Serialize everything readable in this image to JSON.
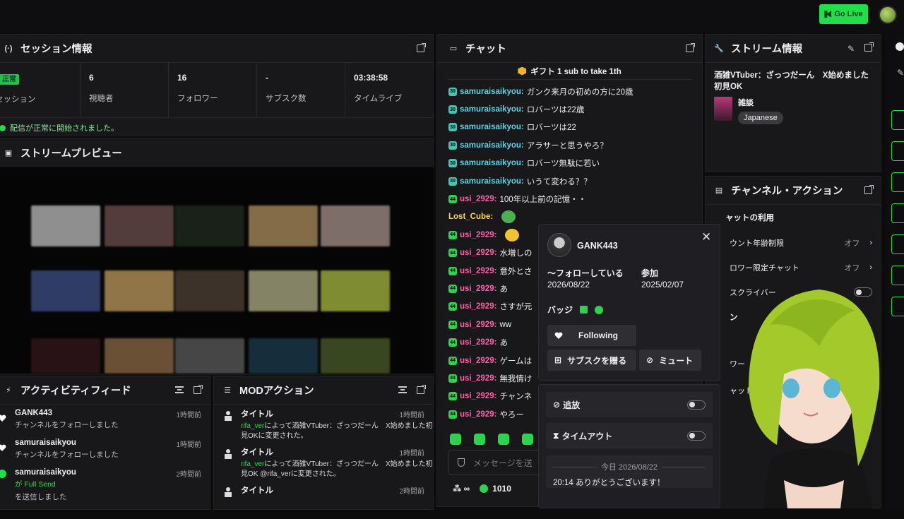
{
  "topbar": {
    "go_live": "Go Live"
  },
  "session": {
    "title": "セッション情報",
    "stats": [
      {
        "value": "正常",
        "label": "セッション",
        "badge": true
      },
      {
        "value": "6",
        "label": "視聴者"
      },
      {
        "value": "16",
        "label": "フォロワー"
      },
      {
        "value": "-",
        "label": "サブスク数"
      },
      {
        "value": "03:38:58",
        "label": "タイムライブ"
      }
    ],
    "status": "配信が正常に開始されました。"
  },
  "preview": {
    "title": "ストリームプレビュー"
  },
  "chat": {
    "title": "チャット",
    "gift": "ギフト 1 sub to take 1th",
    "messages": [
      {
        "user": "samuraisaikyou:",
        "text": "ガンク来月の初めの方に20歳",
        "color": "cyan",
        "badge": "30"
      },
      {
        "user": "samuraisaikyou:",
        "text": "ロバーツは22歳",
        "color": "cyan",
        "badge": "30"
      },
      {
        "user": "samuraisaikyou:",
        "text": "ロバーツは22",
        "color": "cyan",
        "badge": "30"
      },
      {
        "user": "samuraisaikyou:",
        "text": "アラサーと思うやろ？",
        "color": "cyan",
        "badge": "30"
      },
      {
        "user": "samuraisaikyou:",
        "text": "ロバーツ無駄に若い",
        "color": "cyan",
        "badge": "30"
      },
      {
        "user": "samuraisaikyou:",
        "text": "いうて変わる？？",
        "color": "cyan",
        "badge": "30"
      },
      {
        "user": "usi_2929:",
        "text": "100年以上前の記憶・・",
        "color": "pink",
        "badge": "44"
      },
      {
        "user": "Lost_Cube:",
        "text": "",
        "color": "yel",
        "badge": ""
      },
      {
        "user": "usi_2929:",
        "text": "",
        "color": "pink",
        "badge": "44"
      },
      {
        "user": "usi_2929:",
        "text": "水増しの",
        "color": "pink",
        "badge": "44"
      },
      {
        "user": "usi_2929:",
        "text": "意外とさ",
        "color": "pink",
        "badge": "44"
      },
      {
        "user": "usi_2929:",
        "text": "あ",
        "color": "pink",
        "badge": "44"
      },
      {
        "user": "usi_2929:",
        "text": "さすが元",
        "color": "pink",
        "badge": "44"
      },
      {
        "user": "usi_2929:",
        "text": "ww",
        "color": "pink",
        "badge": "44"
      },
      {
        "user": "usi_2929:",
        "text": "あ",
        "color": "pink",
        "badge": "44"
      },
      {
        "user": "usi_2929:",
        "text": "ゲームは",
        "color": "pink",
        "badge": "44"
      },
      {
        "user": "usi_2929:",
        "text": "無我情け",
        "color": "pink",
        "badge": "44"
      },
      {
        "user": "usi_2929:",
        "text": "チャンネ",
        "color": "pink",
        "badge": "44"
      },
      {
        "user": "usi_2929:",
        "text": "やろー",
        "color": "pink",
        "badge": "44"
      }
    ],
    "input_placeholder": "メッセージを送",
    "points": "1010"
  },
  "stream_info": {
    "title": "ストリーム情報",
    "stream_title": "酒雑VTuber：ざっつだーん　X始めました初見OK",
    "category": "雑談",
    "tag": "Japanese"
  },
  "channel_actions": {
    "title": "チャンネル・アクション",
    "section": "ャットの利用",
    "rows": [
      {
        "label": "ウント年齢制限",
        "value": "オフ"
      },
      {
        "label": "ロワー限定チャット",
        "value": "オフ"
      },
      {
        "label": "スクライバー",
        "value": ""
      }
    ],
    "extra1": "ワー",
    "extra2": "ャットモ",
    "extra3": "ン"
  },
  "user_card": {
    "name": "GANK443",
    "following_label": "〜フォローしている",
    "following_date": "2026/08/22",
    "joined_label": "参加",
    "joined_date": "2025/02/07",
    "badges_label": "バッジ",
    "follow_btn": "Following",
    "gift_btn": "サブスクを贈る",
    "mute_btn": "ミュート",
    "ban_label": "追放",
    "timeout_label": "タイムアウト",
    "today": "今日 2026/08/22",
    "last_msg": "20:14 ありがとうございます！"
  },
  "feed": {
    "title": "アクティビティフィード",
    "items": [
      {
        "user": "GANK443",
        "desc": "チャンネルをフォローしました",
        "time": "1時間前"
      },
      {
        "user": "samuraisaikyou",
        "desc": "チャンネルをフォローしました",
        "time": "1時間前"
      },
      {
        "user": "samuraisaikyou",
        "desc": "が Full Send",
        "desc2": "を送信しました",
        "time": "2時間前"
      }
    ]
  },
  "mod": {
    "title": "MODアクション",
    "items": [
      {
        "title": "タイトル",
        "user": "rifa_ver",
        "desc": "によって酒雑VTuber：ざっつだーん　X始めました初見OKに変更された。",
        "time": "1時間前"
      },
      {
        "title": "タイトル",
        "user": "rifa_ver",
        "desc": "によって酒雑VTuber：ざっつだーん　X始めました初見OK @rifa_verに変更された。",
        "time": "1時間前"
      },
      {
        "title": "タイトル",
        "user": "",
        "desc": "",
        "time": "2時間前"
      }
    ]
  },
  "colors": {
    "accent": "#1fe04a",
    "bg": "#18181b",
    "cyan": "#5fd3e6",
    "pink": "#ff5ea9"
  }
}
